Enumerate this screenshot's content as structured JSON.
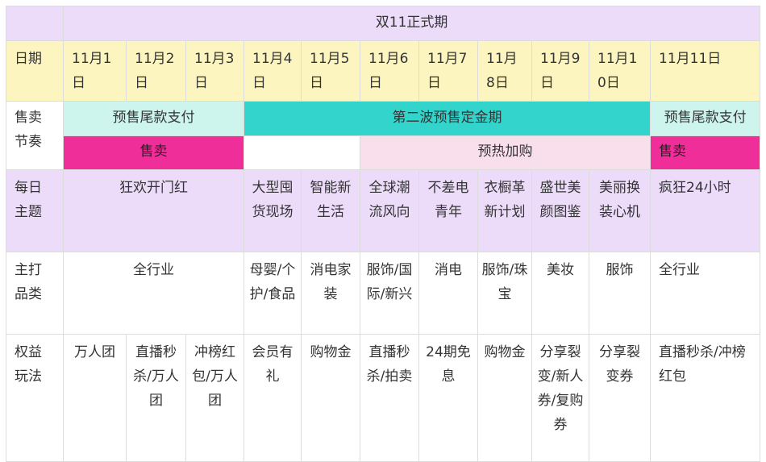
{
  "title": "双11正式期",
  "row_labels": {
    "date": "日期",
    "rhythm": "售卖节奏",
    "theme": "每日主题",
    "category": "主打品类",
    "rights": "权益玩法"
  },
  "dates": [
    "11月1日",
    "11月2日",
    "11月3日",
    "11月4日",
    "11月5日",
    "11月6日",
    "11月7日",
    "11月8日",
    "11月9日",
    "11月10日",
    "11月11日"
  ],
  "rhythm": {
    "balance_payment_1": "预售尾款支付",
    "deposit_phase": "第二波预售定金期",
    "balance_payment_2": "预售尾款支付",
    "sale_1": "售卖",
    "warmup": "预热加购",
    "sale_2": "售卖"
  },
  "themes": [
    "狂欢开门红",
    "大型囤货现场",
    "智能新生活",
    "全球潮流风向",
    "不差电青年",
    "衣橱革新计划",
    "盛世美颜图鉴",
    "美丽换装心机",
    "疯狂24小时"
  ],
  "categories": [
    "全行业",
    "母婴/个护/食品",
    "消电家装",
    "服饰/国际/新兴",
    "消电",
    "服饰/珠宝",
    "美妆",
    "服饰",
    "全行业"
  ],
  "rights": [
    "万人团",
    "直播秒杀/万人团",
    "冲榜红包/万人团",
    "会员有礼",
    "购物金",
    "直播秒杀/拍卖",
    "24期免息",
    "购物金",
    "分享裂变/新人券/复购券",
    "分享裂变券",
    "直播秒杀/冲榜红包"
  ],
  "colors": {
    "lavender": "#ecdcfa",
    "yellow": "#fdf5c0",
    "mint": "#cdf5ee",
    "teal": "#33d4cc",
    "magenta": "#ef2e9a",
    "pink": "#f9dfec"
  }
}
